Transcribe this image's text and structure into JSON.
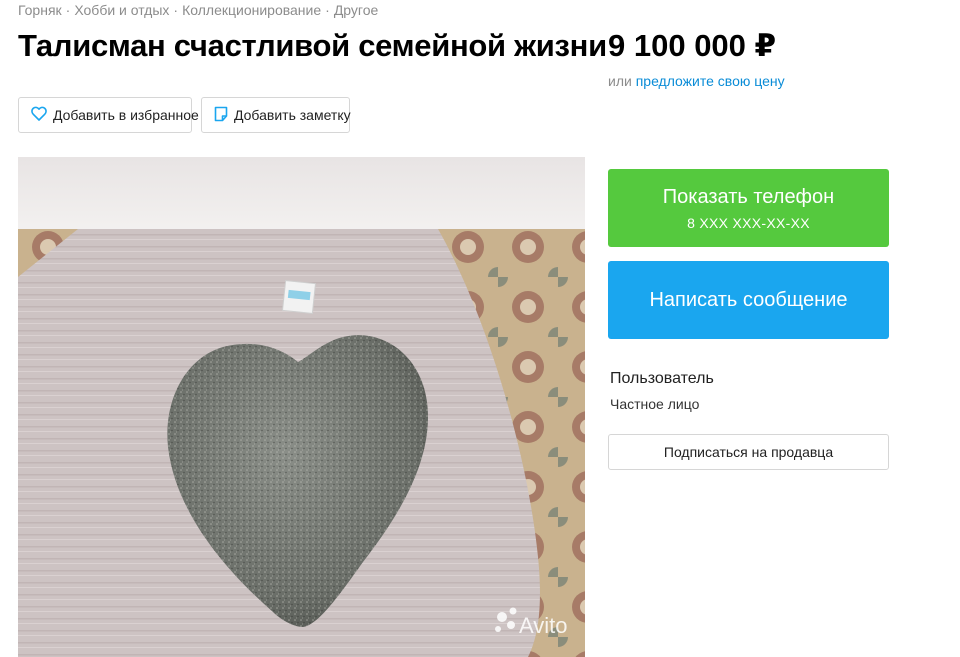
{
  "breadcrumb": {
    "items": [
      "Горняк",
      "Хобби и отдых",
      "Коллекционирование",
      "Другое"
    ],
    "separator": "·"
  },
  "listing": {
    "title": "Талисман счастливой семейной жизни",
    "price": "9 100 000 ₽",
    "offer_prefix": "или",
    "offer_link": "предложите свою цену"
  },
  "actions": {
    "favorite_label": "Добавить в избранное",
    "note_label": "Добавить заметку"
  },
  "photo": {
    "description_icon": "heart-shaped-stone-photo",
    "watermark": "Avito"
  },
  "contact": {
    "phone_button": "Показать телефон",
    "phone_masked": "8 XXX XXX-XX-XX",
    "message_button": "Написать сообщение"
  },
  "seller": {
    "name": "Пользователь",
    "type": "Частное лицо",
    "subscribe_button": "Подписаться на продавца"
  },
  "colors": {
    "green": "#55c93e",
    "blue": "#1aa6ef",
    "link": "#0a8cd7",
    "muted": "#8c8c8c"
  }
}
